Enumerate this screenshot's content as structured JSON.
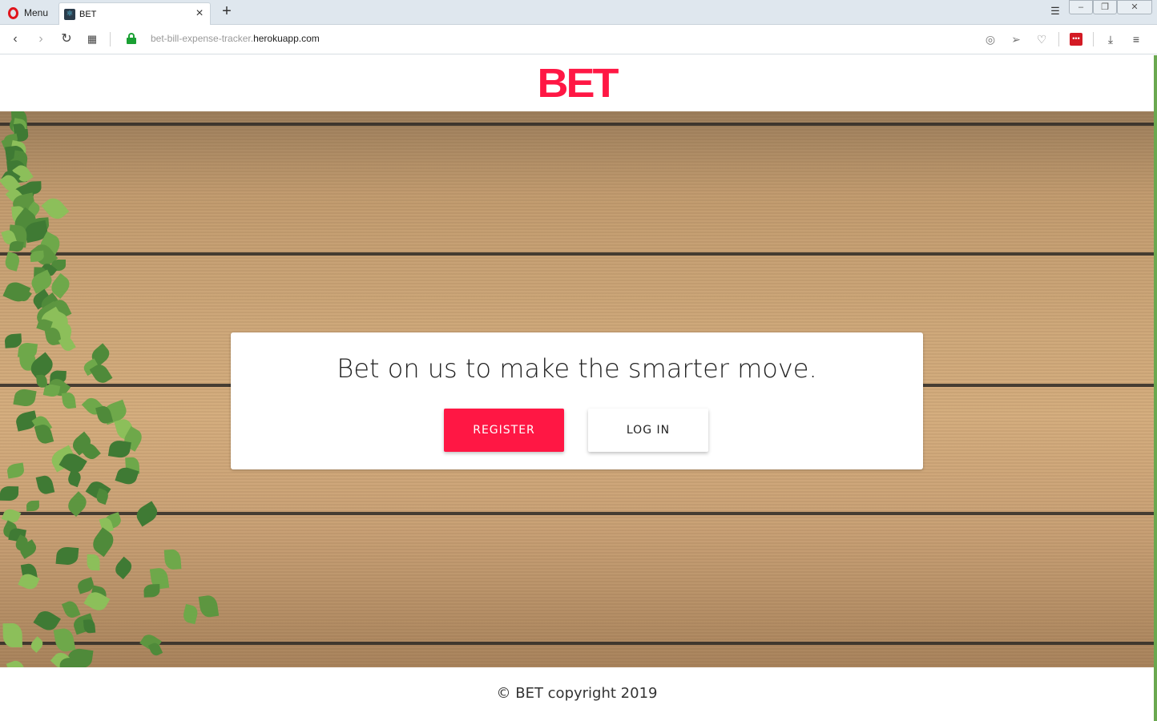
{
  "browser": {
    "menu_label": "Menu",
    "tab_title": "BET",
    "url_path": "bet-bill-expense-tracker.",
    "url_host": "herokuapp.com",
    "icons": {
      "menu": "opera-logo-icon",
      "tab_favicon": "react-favicon-icon",
      "close_tab": "close-icon",
      "new_tab": "plus-icon",
      "back": "chevron-left-icon",
      "forward": "chevron-right-icon",
      "reload": "reload-icon",
      "speed_dial": "grid-icon",
      "secure": "lock-icon",
      "snapshot": "camera-icon",
      "send": "send-icon",
      "bookmark": "heart-icon",
      "extension": "extension-icon",
      "downloads": "download-icon",
      "settings": "easy-setup-icon"
    }
  },
  "site": {
    "logo_text": "BET",
    "tagline": "Bet on us to make the smarter move.",
    "register_label": "REGISTER",
    "login_label": "LOG IN",
    "footer_text": "© BET copyright 2019",
    "colors": {
      "brand": "#ff1744",
      "text": "#222222"
    }
  }
}
